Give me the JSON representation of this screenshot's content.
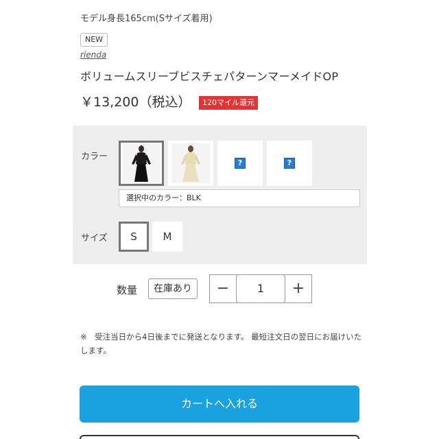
{
  "product": {
    "model_note": "モデル身長165cm(Sサイズ着用)",
    "badge_new": "NEW",
    "brand": "rienda",
    "name": "ボリュームスリーブビスチェパターンマーメイドOP",
    "price": "￥13,200（税込）",
    "mile_badge": "120マイル還元"
  },
  "variants": {
    "color_label": "カラー",
    "colors": [
      {
        "name": "BLK",
        "icon": "dress-photo-black",
        "selected": true
      },
      {
        "name": "",
        "icon": "dress-photo-beige",
        "selected": false
      },
      {
        "name": "",
        "icon": "broken-image-icon",
        "selected": false
      },
      {
        "name": "",
        "icon": "broken-image-icon",
        "selected": false
      }
    ],
    "selected_color_text": "選択中のカラー：BLK",
    "size_label": "サイズ",
    "sizes": [
      {
        "label": "S",
        "selected": true
      },
      {
        "label": "M",
        "selected": false
      }
    ]
  },
  "quantity": {
    "label": "数量",
    "stock": "在庫あり",
    "minus": "−",
    "value": "1",
    "plus": "+"
  },
  "shipping_note": "※　受注当日から4日後までに発送となります。 最短注文日の翌日にお届けいたします。",
  "cart_button": "カートへ入れる",
  "colors": {
    "accent": "#1aa1e0",
    "mile_badge": "#e63232",
    "panel_bg": "#eeeeee"
  }
}
